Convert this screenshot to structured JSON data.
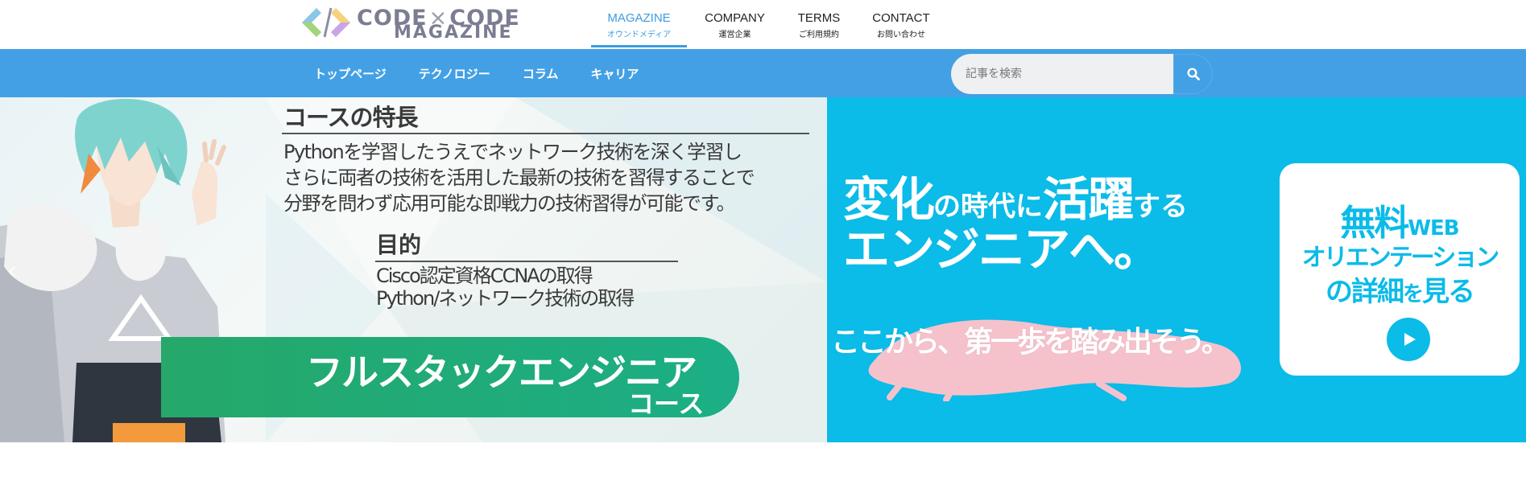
{
  "logo": {
    "line1_left": "CODE",
    "line1_times": "×",
    "line1_right": "CODE",
    "line2": "MAGAZINE",
    "icon": "code-brackets-logo-icon"
  },
  "top_nav": [
    {
      "label": "MAGAZINE",
      "sub": "オウンドメディア",
      "active": true
    },
    {
      "label": "COMPANY",
      "sub": "運営企業",
      "active": false
    },
    {
      "label": "TERMS",
      "sub": "ご利用規約",
      "active": false
    },
    {
      "label": "CONTACT",
      "sub": "お問い合わせ",
      "active": false
    }
  ],
  "category_nav": [
    "トップページ",
    "テクノロジー",
    "コラム",
    "キャリア"
  ],
  "search": {
    "placeholder": "記事を検索",
    "icon": "search-icon"
  },
  "slide_left": {
    "feature_title": "コースの特長",
    "feature_lines": [
      "Pythonを学習したうえでネットワーク技術を深く学習し",
      "さらに両者の技術を活用した最新の技術を習得することで",
      "分野を問わず応用可能な即戦力の技術習得が可能です。"
    ],
    "purpose_title": "目的",
    "purpose_lines": [
      "Cisco認定資格CCNAの取得",
      "Python/ネットワーク技術の取得"
    ],
    "course_main": "フルスタックエンジニア",
    "course_sub": "コース"
  },
  "slide_right": {
    "headline1_a": "変化",
    "headline1_b": "の時代に",
    "headline1_c": "活躍",
    "headline1_d": "する",
    "headline2": "エンジニアへ。",
    "tagline": "ここから、第一歩を踏み出そう。",
    "cta_free": "無料",
    "cta_web": "WEB",
    "cta_line2": "オリエンテーション",
    "cta_line3_a": "の詳細",
    "cta_line3_b": "を",
    "cta_line3_c": "見る",
    "cta_icon": "play-icon"
  },
  "slider_arrows": {
    "prev": "‹",
    "next": "›"
  },
  "colors": {
    "accent": "#3a9de0",
    "category_bar": "#43a0e4",
    "banner_blue": "#0bbbe8",
    "course_green": "#25a86a",
    "brush_pink": "#f5c2cc"
  }
}
